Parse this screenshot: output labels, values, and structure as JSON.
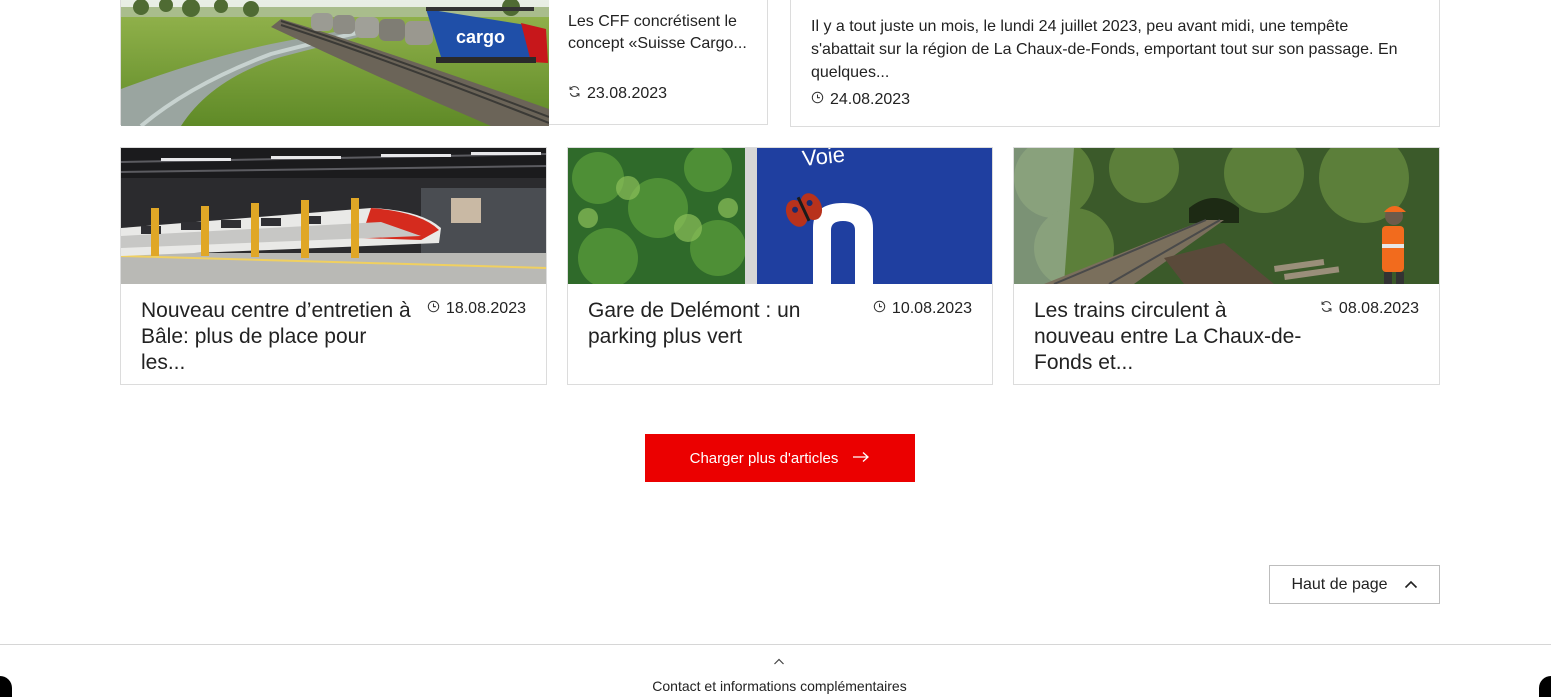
{
  "top_row": {
    "left_card": {
      "excerpt": "Les CFF concrétisent le concept «Suisse Cargo...",
      "date": "23.08.2023",
      "date_icon": "refresh-icon",
      "image_text": "cargo"
    },
    "right_card": {
      "excerpt": "Il y a tout juste un mois, le lundi 24 juillet 2023, peu avant midi, une tempête s'abattait sur la région de La Chaux-de-Fonds, emportant tout sur son passage. En quelques...",
      "date": "24.08.2023",
      "date_icon": "clock-icon"
    }
  },
  "articles": [
    {
      "title": "Nouveau centre d’entretien à Bâle: plus de place pour les...",
      "date": "18.08.2023",
      "date_icon": "clock-icon"
    },
    {
      "title": "Gare de Delémont : un parking plus vert",
      "date": "10.08.2023",
      "date_icon": "clock-icon",
      "image_text": "Voie"
    },
    {
      "title": "Les trains circulent à nouveau entre La Chaux-de-Fonds et...",
      "date": "08.08.2023",
      "date_icon": "refresh-icon"
    }
  ],
  "load_more": {
    "label": "Charger plus d'articles",
    "icon": "arrow-right-icon"
  },
  "back_to_top": {
    "label": "Haut de page",
    "icon": "chevron-up-icon"
  },
  "footer": {
    "label": "Contact et informations complémentaires",
    "icon": "chevron-up-icon"
  },
  "colors": {
    "accent": "#eb0000",
    "border": "#dcdcdc",
    "text": "#222222"
  }
}
